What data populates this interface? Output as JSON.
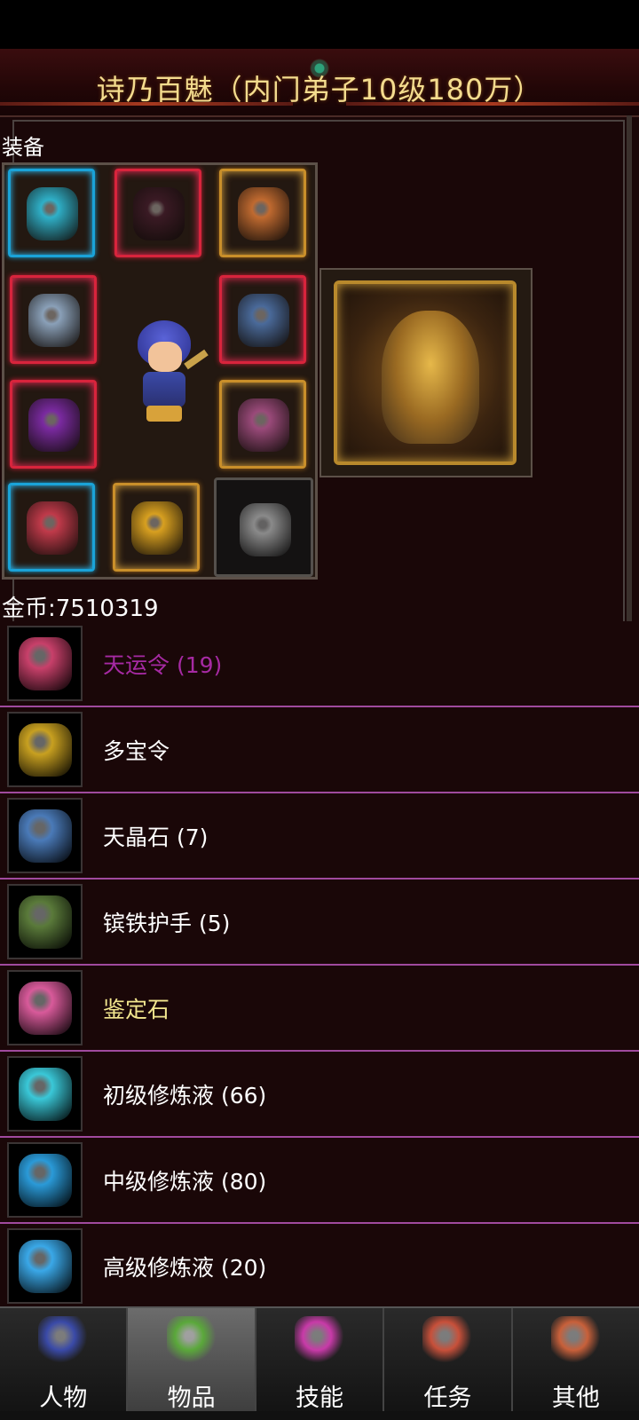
{
  "header": {
    "title": "诗乃百魅（内门弟子10级180万）"
  },
  "equipment": {
    "label": "装备",
    "slots": [
      {
        "icon": "helmet-icon",
        "rarity": "blue",
        "color": "#2fb0c8"
      },
      {
        "icon": "wings-icon",
        "rarity": "red",
        "color": "#3a1a24"
      },
      {
        "icon": "amulet-icon",
        "rarity": "gold",
        "color": "#c06a30"
      },
      {
        "icon": "sword-icon",
        "rarity": "red",
        "color": "#8aa0b8"
      },
      {
        "icon": "blade-icon",
        "rarity": "red",
        "color": "#4a6a9a"
      },
      {
        "icon": "gauntlet-icon",
        "rarity": "red",
        "color": "#7a2aa0"
      },
      {
        "icon": "bracer-icon",
        "rarity": "gold",
        "color": "#9a4a7a"
      },
      {
        "icon": "boots-icon",
        "rarity": "blue",
        "color": "#c03a4a"
      },
      {
        "icon": "belt-icon",
        "rarity": "gold",
        "color": "#d8a020"
      },
      {
        "icon": "ring-icon",
        "rarity": "plain",
        "color": "#8a8a8a"
      }
    ],
    "featured_icon": "mount-beast-icon"
  },
  "gold": {
    "label": "金币:7510319"
  },
  "items": [
    {
      "name": "天运令 (19)",
      "color": "purple",
      "icon": "fortune-token-icon",
      "icon_color": "#c8406a"
    },
    {
      "name": "多宝令",
      "color": "white",
      "icon": "treasure-token-icon",
      "icon_color": "#c8a020"
    },
    {
      "name": "天晶石 (7)",
      "color": "white",
      "icon": "crystal-stone-icon",
      "icon_color": "#4a7ab8"
    },
    {
      "name": "镔铁护手 (5)",
      "color": "white",
      "icon": "iron-gauntlet-icon",
      "icon_color": "#5a7a3a"
    },
    {
      "name": "鉴定石",
      "color": "yellow",
      "icon": "appraisal-stone-icon",
      "icon_color": "#d85a9a"
    },
    {
      "name": "初级修炼液 (66)",
      "color": "white",
      "icon": "potion-vial-icon",
      "icon_color": "#3ac8d8"
    },
    {
      "name": "中级修炼液 (80)",
      "color": "white",
      "icon": "potion-flask-icon",
      "icon_color": "#2a9ad8"
    },
    {
      "name": "高级修炼液 (20)",
      "color": "white",
      "icon": "potion-bottle-icon",
      "icon_color": "#3aa8e8"
    }
  ],
  "tabs": [
    {
      "label": "人物",
      "icon": "character-icon",
      "active": false,
      "color": "#3a4aa8"
    },
    {
      "label": "物品",
      "icon": "items-potion-icon",
      "active": true,
      "color": "#5aa83a"
    },
    {
      "label": "技能",
      "icon": "skills-icon",
      "active": false,
      "color": "#c83aa8"
    },
    {
      "label": "任务",
      "icon": "quests-icon",
      "active": false,
      "color": "#c8503a"
    },
    {
      "label": "其他",
      "icon": "other-icon",
      "active": false,
      "color": "#c8603a"
    }
  ]
}
